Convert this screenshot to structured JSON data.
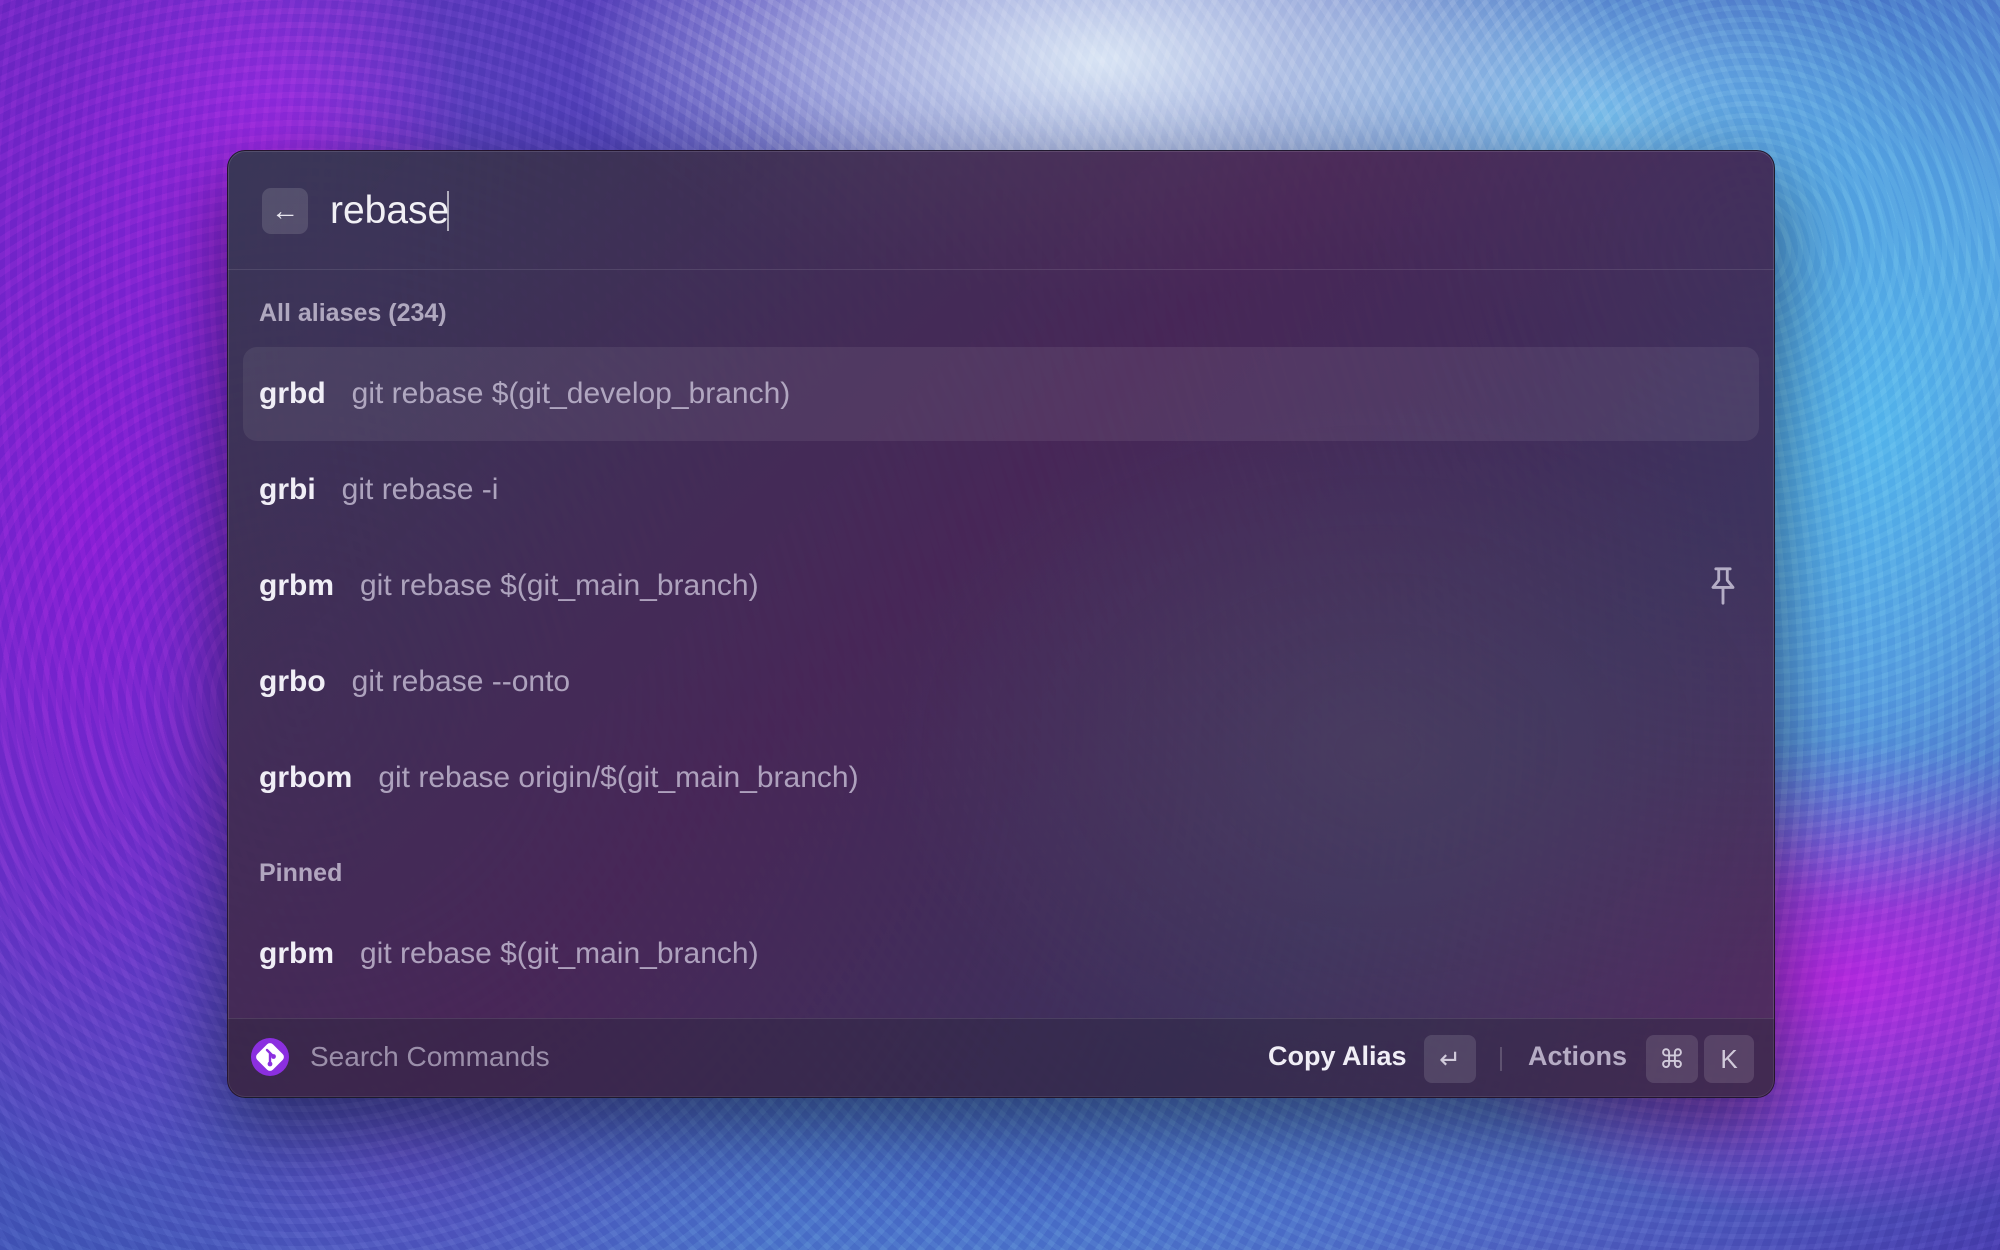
{
  "search": {
    "value": "rebase",
    "back_icon": "arrow-left-icon",
    "back_glyph": "←"
  },
  "sections": [
    {
      "title": "All aliases (234)",
      "items": [
        {
          "alias": "grbd",
          "command": "git rebase $(git_develop_branch)",
          "selected": true
        },
        {
          "alias": "grbi",
          "command": "git rebase -i"
        },
        {
          "alias": "grbm",
          "command": "git rebase $(git_main_branch)",
          "pinned_icon": "pin-icon"
        },
        {
          "alias": "grbo",
          "command": "git rebase --onto"
        },
        {
          "alias": "grbom",
          "command": "git rebase origin/$(git_main_branch)"
        }
      ]
    },
    {
      "title": "Pinned",
      "items": [
        {
          "alias": "grbm",
          "command": "git rebase $(git_main_branch)"
        }
      ]
    }
  ],
  "footer": {
    "app_icon": "git-logo-icon",
    "search_placeholder": "Search Commands",
    "primary_action": "Copy Alias",
    "enter_key": "↵",
    "actions_label": "Actions",
    "cmd_key": "⌘",
    "k_key": "K"
  },
  "colors": {
    "accent": "#8b2fe0",
    "text_primary": "#f0eef6"
  }
}
